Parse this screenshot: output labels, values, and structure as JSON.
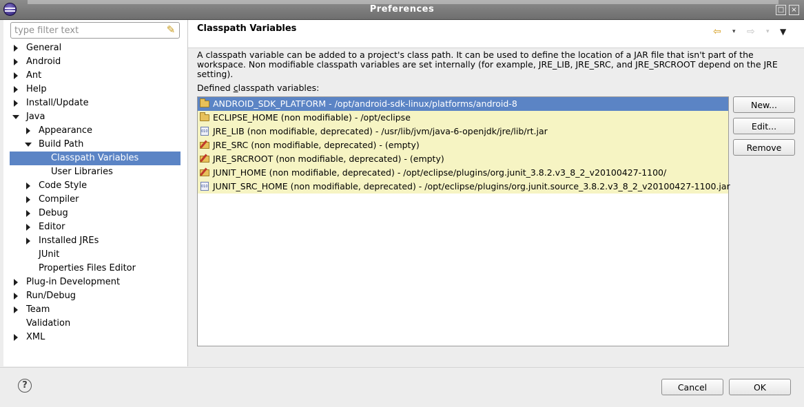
{
  "window": {
    "title": "Preferences"
  },
  "filter": {
    "placeholder": "type filter text"
  },
  "tree": [
    {
      "label": "General",
      "twisty": "closed",
      "level": 0,
      "selected": false
    },
    {
      "label": "Android",
      "twisty": "closed",
      "level": 0,
      "selected": false
    },
    {
      "label": "Ant",
      "twisty": "closed",
      "level": 0,
      "selected": false
    },
    {
      "label": "Help",
      "twisty": "closed",
      "level": 0,
      "selected": false
    },
    {
      "label": "Install/Update",
      "twisty": "closed",
      "level": 0,
      "selected": false
    },
    {
      "label": "Java",
      "twisty": "open",
      "level": 0,
      "selected": false
    },
    {
      "label": "Appearance",
      "twisty": "closed",
      "level": 1,
      "selected": false
    },
    {
      "label": "Build Path",
      "twisty": "open",
      "level": 1,
      "selected": false
    },
    {
      "label": "Classpath Variables",
      "twisty": "none",
      "level": 2,
      "selected": true
    },
    {
      "label": "User Libraries",
      "twisty": "none",
      "level": 2,
      "selected": false
    },
    {
      "label": "Code Style",
      "twisty": "closed",
      "level": 1,
      "selected": false
    },
    {
      "label": "Compiler",
      "twisty": "closed",
      "level": 1,
      "selected": false
    },
    {
      "label": "Debug",
      "twisty": "closed",
      "level": 1,
      "selected": false
    },
    {
      "label": "Editor",
      "twisty": "closed",
      "level": 1,
      "selected": false
    },
    {
      "label": "Installed JREs",
      "twisty": "closed",
      "level": 1,
      "selected": false
    },
    {
      "label": "JUnit",
      "twisty": "none",
      "level": 1,
      "selected": false
    },
    {
      "label": "Properties Files Editor",
      "twisty": "none",
      "level": 1,
      "selected": false
    },
    {
      "label": "Plug-in Development",
      "twisty": "closed",
      "level": 0,
      "selected": false
    },
    {
      "label": "Run/Debug",
      "twisty": "closed",
      "level": 0,
      "selected": false
    },
    {
      "label": "Team",
      "twisty": "closed",
      "level": 0,
      "selected": false
    },
    {
      "label": "Validation",
      "twisty": "none",
      "level": 0,
      "selected": false
    },
    {
      "label": "XML",
      "twisty": "closed",
      "level": 0,
      "selected": false
    }
  ],
  "page": {
    "title": "Classpath Variables",
    "description": "A classpath variable can be added to a project's class path. It can be used to define the location of a JAR file that isn't part of the workspace. Non modifiable classpath variables are set internally (for example, JRE_LIB, JRE_SRC, and JRE_SRCROOT depend on the JRE setting).",
    "defined_label_prefix": "Defined ",
    "defined_label_mnemonic": "c",
    "defined_label_rest": "lasspath variables:"
  },
  "variables": [
    {
      "text": "ANDROID_SDK_PLATFORM - /opt/android-sdk-linux/platforms/android-8",
      "icon": "open-folder-icon",
      "selected": true
    },
    {
      "text": "ECLIPSE_HOME (non modifiable) - /opt/eclipse",
      "icon": "open-folder-icon",
      "selected": false
    },
    {
      "text": "JRE_LIB (non modifiable, deprecated) - /usr/lib/jvm/java-6-openjdk/jre/lib/rt.jar",
      "icon": "jar-file-icon",
      "selected": false
    },
    {
      "text": "JRE_SRC (non modifiable, deprecated) - (empty)",
      "icon": "edit-folder-icon",
      "selected": false
    },
    {
      "text": "JRE_SRCROOT (non modifiable, deprecated) - (empty)",
      "icon": "edit-folder-icon",
      "selected": false
    },
    {
      "text": "JUNIT_HOME (non modifiable, deprecated) - /opt/eclipse/plugins/org.junit_3.8.2.v3_8_2_v20100427-1100/",
      "icon": "edit-folder-icon",
      "selected": false
    },
    {
      "text": "JUNIT_SRC_HOME (non modifiable, deprecated) - /opt/eclipse/plugins/org.junit.source_3.8.2.v3_8_2_v20100427-1100.jar",
      "icon": "jar-file-icon",
      "selected": false
    }
  ],
  "buttons": {
    "new": "New...",
    "edit": "Edit...",
    "remove": "Remove",
    "cancel": "Cancel",
    "ok": "OK"
  },
  "help_symbol": "?",
  "colors": {
    "selection": "#5b84c5",
    "row_highlight": "#f6f4c3",
    "titlebar": "#7d7d7d"
  }
}
